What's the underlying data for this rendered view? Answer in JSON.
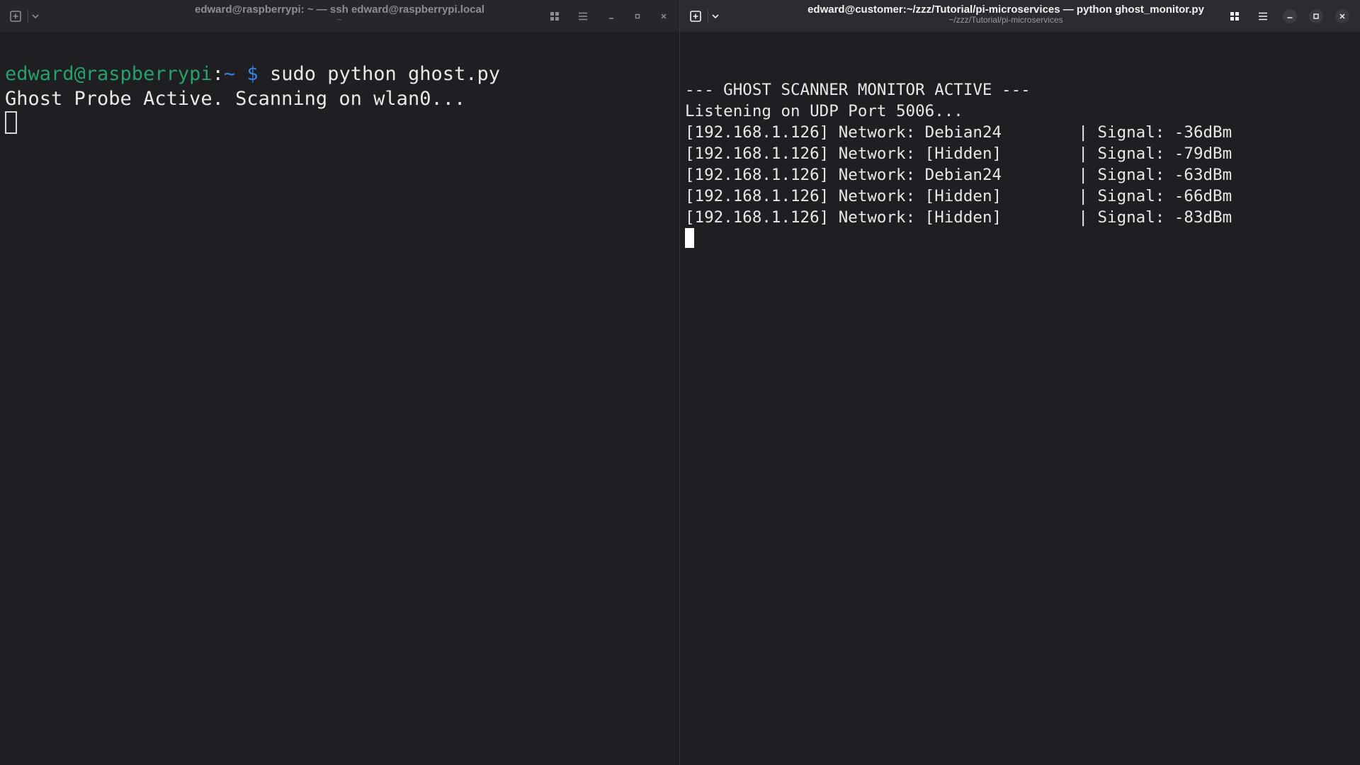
{
  "left_window": {
    "title": "edward@raspberrypi: ~ — ssh edward@raspberrypi.local",
    "subtitle": "~",
    "icons": [
      "new-tab-icon",
      "chevron-down-icon",
      "grid-icon",
      "menu-icon",
      "minimize-icon",
      "maximize-icon",
      "close-icon"
    ],
    "prompt_user": "edward@raspberrypi",
    "prompt_colon": ":",
    "prompt_path": "~",
    "prompt_dollar": "$",
    "command": "sudo python ghost.py",
    "output": [
      "Ghost Probe Active. Scanning on wlan0..."
    ]
  },
  "right_window": {
    "title": "edward@customer:~/zzz/Tutorial/pi-microservices — python ghost_monitor.py",
    "subtitle": "~/zzz/Tutorial/pi-microservices",
    "icons": [
      "new-tab-icon",
      "chevron-down-icon",
      "grid-icon",
      "menu-icon",
      "minimize-icon",
      "maximize-icon",
      "close-icon"
    ],
    "header_lines": [
      "--- GHOST SCANNER MONITOR ACTIVE ---",
      "Listening on UDP Port 5006..."
    ],
    "rows": [
      {
        "ip": "[192.168.1.126]",
        "network": "Network: Debian24       ",
        "signal": "| Signal: -36dBm"
      },
      {
        "ip": "[192.168.1.126]",
        "network": "Network: [Hidden]       ",
        "signal": "| Signal: -79dBm"
      },
      {
        "ip": "[192.168.1.126]",
        "network": "Network: Debian24       ",
        "signal": "| Signal: -63dBm"
      },
      {
        "ip": "[192.168.1.126]",
        "network": "Network: [Hidden]       ",
        "signal": "| Signal: -66dBm"
      },
      {
        "ip": "[192.168.1.126]",
        "network": "Network: [Hidden]       ",
        "signal": "| Signal: -83dBm"
      }
    ]
  },
  "colors": {
    "background": "#1e1e23",
    "titlebar_active": "#2b2b31",
    "prompt_user": "#26a269",
    "prompt_path": "#3584e4"
  }
}
